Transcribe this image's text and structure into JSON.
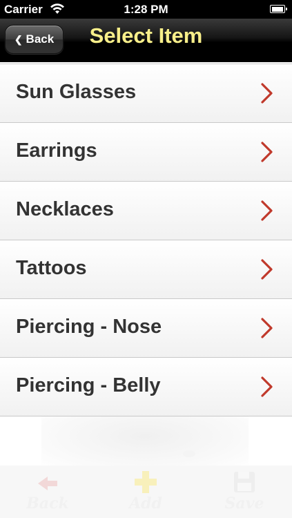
{
  "status_bar": {
    "carrier": "Carrier",
    "time": "1:28 PM"
  },
  "nav": {
    "back_label": "Back",
    "title": "Select Item",
    "title_color": "#f8ef8a"
  },
  "items": [
    {
      "label": "Sun Glasses"
    },
    {
      "label": "Earrings"
    },
    {
      "label": "Necklaces"
    },
    {
      "label": "Tattoos"
    },
    {
      "label": "Piercing - Nose"
    },
    {
      "label": "Piercing - Belly"
    }
  ],
  "toolbar": {
    "back_label": "Back",
    "add_label": "Add",
    "save_label": "Save"
  },
  "colors": {
    "chevron": "#c0392b"
  }
}
